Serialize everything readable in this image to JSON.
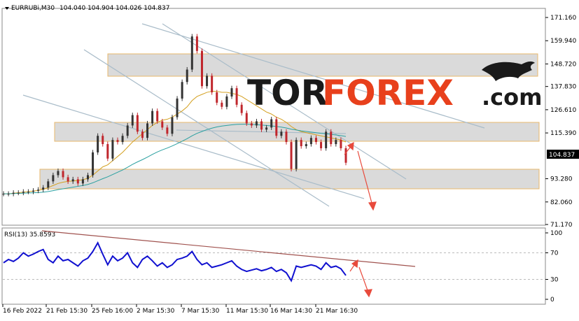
{
  "header": {
    "dropdown_icon": "triangle-down-icon",
    "symbol": "EURRUBi,M30",
    "ohlc": "104.040 104.904 104.026 104.837"
  },
  "logo": {
    "part1": "TOR",
    "part2": "FOREX",
    "part3": ".com",
    "icon": "bull-icon",
    "colors": {
      "dark": "#1a1a1a",
      "accent": "#e8401c"
    }
  },
  "rsi_panel": {
    "label": "RSI(13) 35.8593",
    "levels": [
      "100",
      "70",
      "30",
      "0"
    ],
    "level_values": [
      100,
      70,
      30,
      0
    ]
  },
  "chart_data": [
    {
      "type": "candlestick",
      "symbol": "EURRUBi",
      "timeframe": "M30",
      "y_ticks": [
        171.16,
        159.94,
        148.72,
        137.83,
        126.61,
        115.39,
        104.837,
        93.28,
        82.06,
        71.17
      ],
      "y_tick_labels": [
        "171.160",
        "159.940",
        "148.720",
        "137.830",
        "126.610",
        "115.390",
        "104.837",
        "93.280",
        "82.060",
        "71.170"
      ],
      "current_price": 104.837,
      "current_price_label": "104.837",
      "ylim": [
        71.17,
        171.16
      ],
      "x_tick_labels": [
        "16 Feb 2022",
        "21 Feb 15:30",
        "25 Feb 16:00",
        "2 Mar 15:30",
        "7 Mar 15:30",
        "11 Mar 15:30",
        "16 Mar 14:30",
        "21 Mar 16:30"
      ],
      "close_series": [
        86,
        86,
        86.5,
        86.5,
        87,
        87,
        87.5,
        88,
        89,
        92,
        95,
        97,
        94,
        92,
        93,
        91,
        93,
        95,
        106,
        114,
        110,
        103,
        112,
        111,
        114,
        119,
        124,
        116,
        113,
        120,
        126,
        121,
        118,
        115,
        123,
        132,
        140,
        146,
        162,
        155,
        138,
        143,
        135,
        130,
        128,
        133,
        137,
        129,
        125,
        120,
        119,
        121,
        117,
        118,
        122,
        114,
        116,
        111,
        98,
        112,
        109,
        110,
        113,
        111,
        108,
        116,
        110,
        112,
        108,
        101
      ],
      "moving_averages": [
        {
          "color": "#d4a020",
          "values": [
            86,
            86,
            86.3,
            86.5,
            86.8,
            87,
            87.3,
            87.6,
            88.2,
            89,
            90,
            91,
            91.6,
            92,
            92.2,
            92.4,
            92.8,
            93.5,
            95,
            97,
            99,
            100,
            102,
            104,
            106,
            108.5,
            111,
            113,
            115,
            117,
            119,
            120.5,
            121.5,
            122,
            123,
            124.5,
            126,
            128,
            131,
            133,
            134,
            135,
            135.5,
            135.5,
            135,
            135,
            134.5,
            134,
            133,
            131.5,
            130,
            128.5,
            127,
            125.5,
            124.5,
            123,
            122,
            120.5,
            118.5,
            117,
            116,
            115.5,
            115,
            114.5,
            114,
            113.5,
            113,
            112.5,
            112,
            111
          ]
        },
        {
          "color": "#2aa0a0",
          "values": [
            86,
            86,
            86.1,
            86.2,
            86.3,
            86.4,
            86.5,
            86.6,
            86.8,
            87.1,
            87.5,
            88,
            88.4,
            88.8,
            89.2,
            89.6,
            90,
            90.5,
            91.3,
            92.3,
            93.3,
            94.2,
            95.3,
            96.4,
            97.5,
            98.8,
            100.2,
            101.4,
            102.5,
            103.7,
            105,
            106.2,
            107.2,
            108.1,
            109.1,
            110.2,
            111.4,
            112.6,
            114,
            115.2,
            116.1,
            117,
            117.7,
            118.3,
            118.7,
            119,
            119.3,
            119.5,
            119.6,
            119.6,
            119.5,
            119.4,
            119.2,
            119,
            118.8,
            118.5,
            118.2,
            117.8,
            117.2,
            116.8,
            116.4,
            116.1,
            115.8,
            115.5,
            115.2,
            115,
            114.7,
            114.4,
            114.1,
            113.7
          ]
        }
      ]
    },
    {
      "type": "line",
      "name": "RSI(13)",
      "ylim": [
        0,
        100
      ],
      "y_tick_labels": [
        "100",
        "70",
        "30",
        "0"
      ],
      "values": [
        55,
        60,
        57,
        62,
        70,
        65,
        68,
        72,
        75,
        60,
        55,
        65,
        58,
        60,
        55,
        50,
        58,
        62,
        72,
        85,
        68,
        52,
        65,
        58,
        62,
        70,
        55,
        48,
        60,
        65,
        58,
        50,
        55,
        48,
        52,
        60,
        62,
        65,
        72,
        60,
        52,
        55,
        48,
        50,
        52,
        55,
        58,
        50,
        45,
        42,
        44,
        46,
        43,
        45,
        48,
        42,
        45,
        40,
        28,
        50,
        48,
        50,
        52,
        50,
        45,
        55,
        48,
        50,
        46,
        36
      ]
    }
  ]
}
